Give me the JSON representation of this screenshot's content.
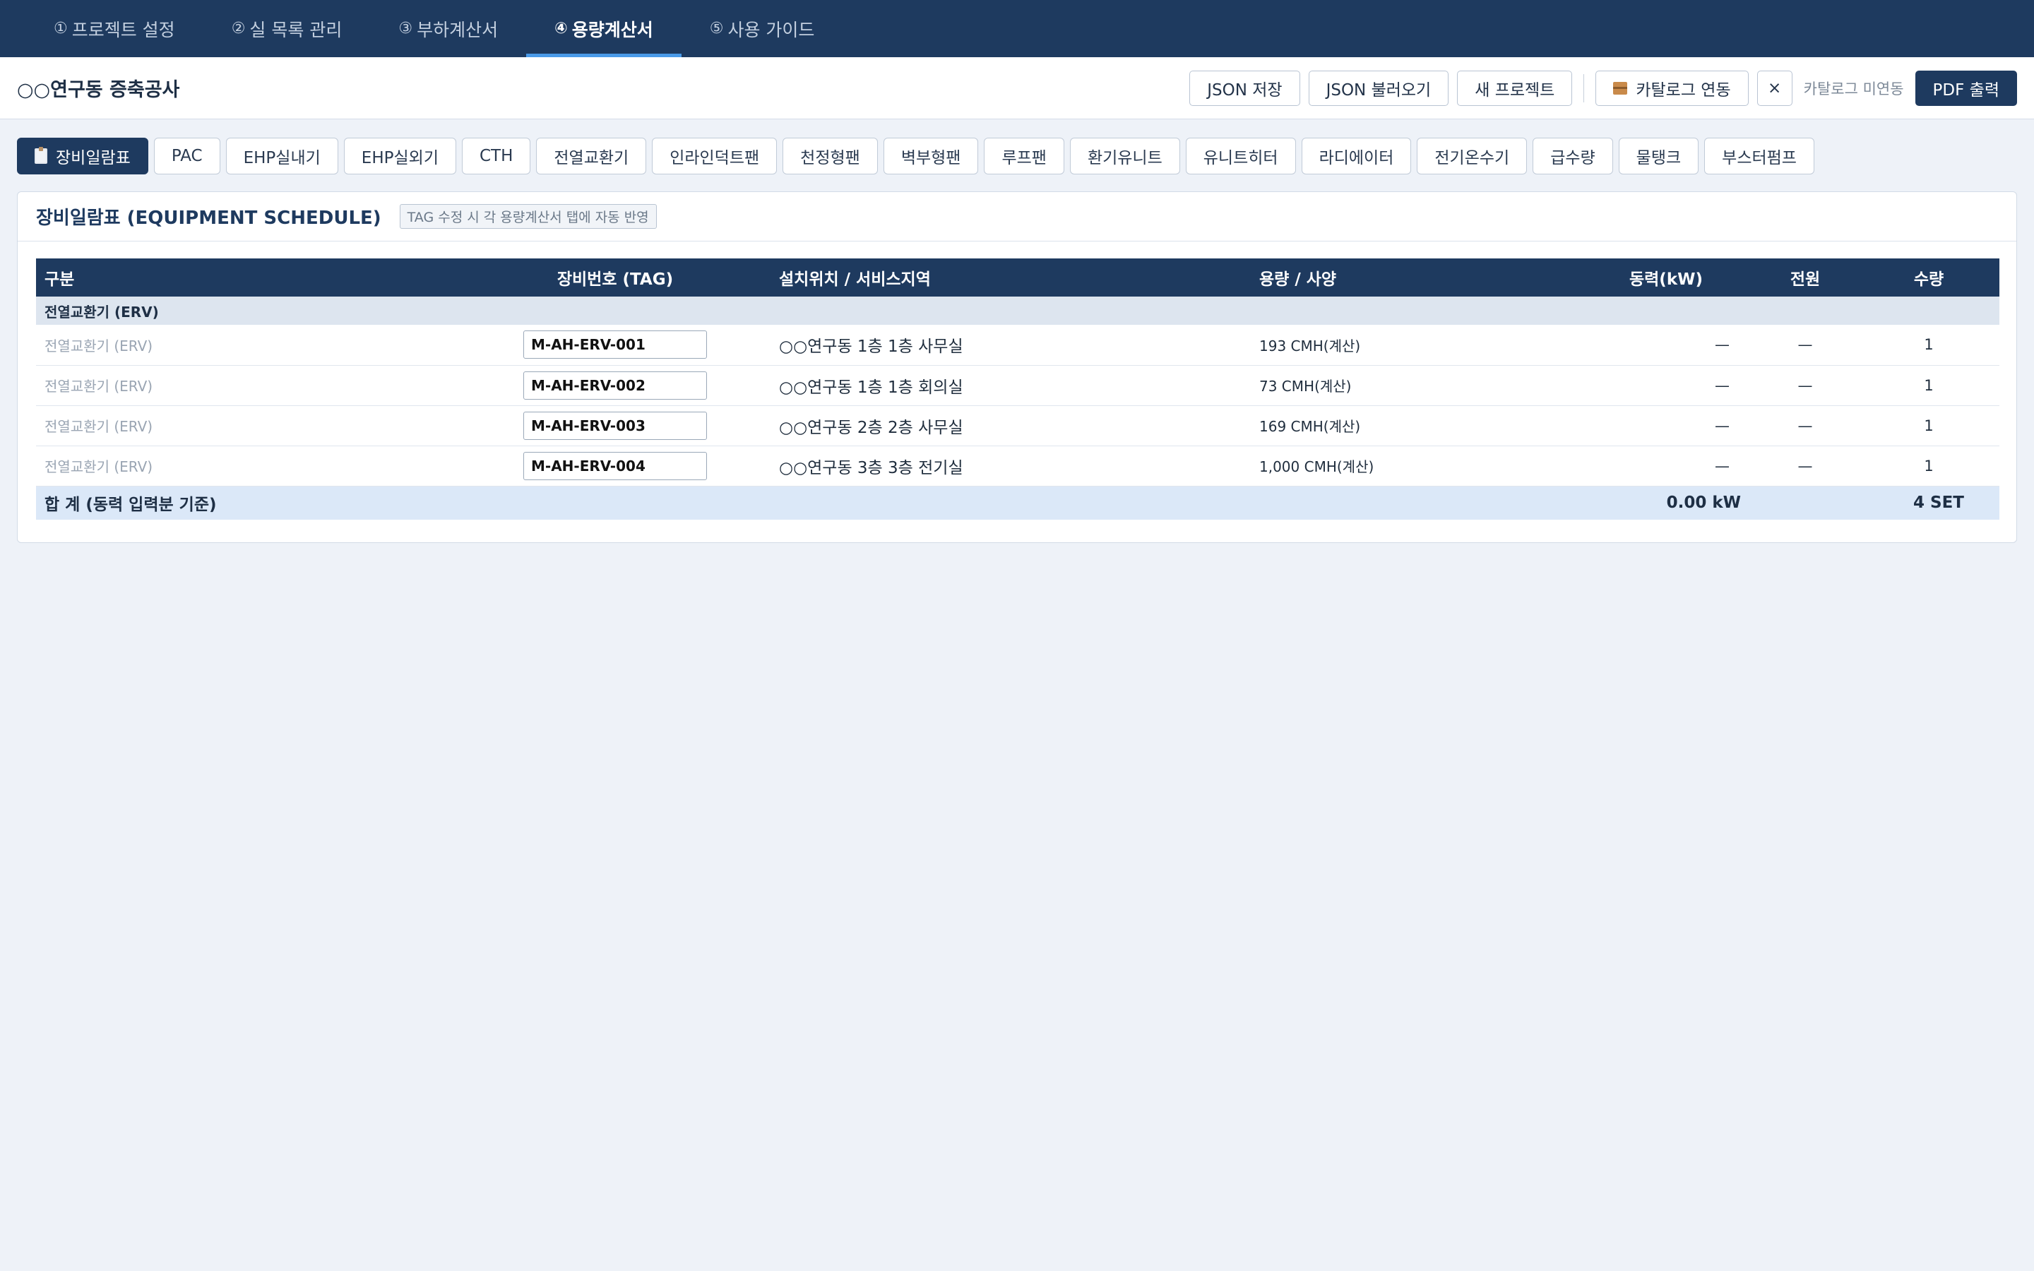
{
  "nav": {
    "tabs": [
      {
        "num": "①",
        "label": "프로젝트 설정"
      },
      {
        "num": "②",
        "label": "실 목록 관리"
      },
      {
        "num": "③",
        "label": "부하계산서"
      },
      {
        "num": "④",
        "label": "용량계산서"
      },
      {
        "num": "⑤",
        "label": "사용 가이드"
      }
    ],
    "active_index": 3
  },
  "header": {
    "project_title": "○○연구동 증축공사",
    "json_save": "JSON 저장",
    "json_load": "JSON 불러오기",
    "new_project": "새 프로젝트",
    "catalog_link": "카탈로그 연동",
    "close_symbol": "×",
    "catalog_status": "카탈로그 미연동",
    "pdf_export": "PDF 출력"
  },
  "equipment_tabs": [
    "장비일람표",
    "PAC",
    "EHP실내기",
    "EHP실외기",
    "CTH",
    "전열교환기",
    "인라인덕트팬",
    "천정형팬",
    "벽부형팬",
    "루프팬",
    "환기유니트",
    "유니트히터",
    "라디에이터",
    "전기온수기",
    "급수량",
    "물탱크",
    "부스터펌프"
  ],
  "panel": {
    "title": "장비일람표 (EQUIPMENT SCHEDULE)",
    "badge": "TAG 수정 시 각 용량계산서 탭에 자동 반영"
  },
  "table": {
    "headers": {
      "category": "구분",
      "tag": "장비번호 (TAG)",
      "location": "설치위치 / 서비스지역",
      "capacity": "용량 / 사양",
      "power": "동력(kW)",
      "supply": "전원",
      "qty": "수량"
    },
    "group_label": "전열교환기 (ERV)",
    "rows": [
      {
        "category": "전열교환기 (ERV)",
        "tag": "M-AH-ERV-001",
        "location": "○○연구동 1층 1층 사무실",
        "capacity": "193 CMH(계산)",
        "power": "—",
        "supply": "—",
        "qty": "1"
      },
      {
        "category": "전열교환기 (ERV)",
        "tag": "M-AH-ERV-002",
        "location": "○○연구동 1층 1층 회의실",
        "capacity": "73 CMH(계산)",
        "power": "—",
        "supply": "—",
        "qty": "1"
      },
      {
        "category": "전열교환기 (ERV)",
        "tag": "M-AH-ERV-003",
        "location": "○○연구동 2층 2층 사무실",
        "capacity": "169 CMH(계산)",
        "power": "—",
        "supply": "—",
        "qty": "1"
      },
      {
        "category": "전열교환기 (ERV)",
        "tag": "M-AH-ERV-004",
        "location": "○○연구동 3층 3층 전기실",
        "capacity": "1,000 CMH(계산)",
        "power": "—",
        "supply": "—",
        "qty": "1"
      }
    ],
    "total": {
      "label": "합 계 (동력 입력분 기준)",
      "power": "0.00 kW",
      "qty": "4 SET"
    }
  }
}
